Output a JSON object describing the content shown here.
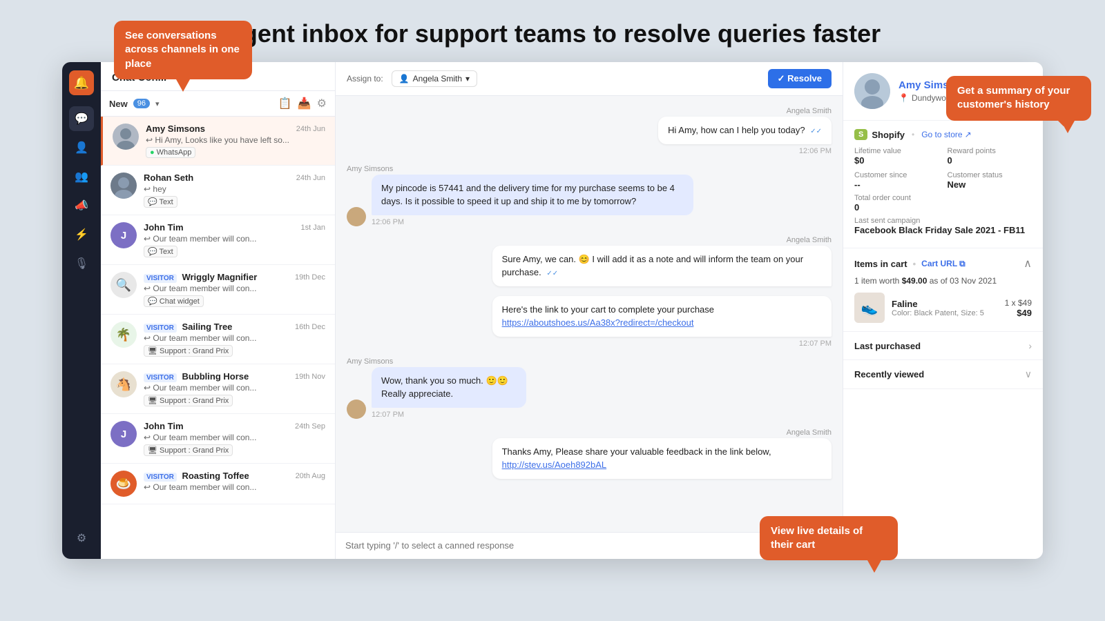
{
  "page": {
    "title": "Agent inbox for support teams to resolve queries faster"
  },
  "sidebar": {
    "logo_icon": "🔔",
    "items": [
      {
        "name": "conversations",
        "icon": "💬",
        "active": true
      },
      {
        "name": "contacts",
        "icon": "👤"
      },
      {
        "name": "teams",
        "icon": "👥"
      },
      {
        "name": "campaigns",
        "icon": "📣"
      },
      {
        "name": "automation",
        "icon": "⚡"
      },
      {
        "name": "reports",
        "icon": "🎙"
      },
      {
        "name": "settings",
        "icon": "⚙"
      }
    ]
  },
  "conv_list": {
    "header": "Chat Con...",
    "filter_label": "New",
    "filter_count": "96",
    "items": [
      {
        "name": "Amy Simsons",
        "snippet": "Hi Amy, Looks like you have left so...",
        "date": "24th Jun",
        "channel": "WhatsApp",
        "channel_icon": "💬",
        "avatar_text": "A",
        "avatar_class": "avatar-gray",
        "active": true
      },
      {
        "name": "Rohan Seth",
        "snippet": "hey",
        "date": "24th Jun",
        "channel": "Text",
        "channel_icon": "💬",
        "avatar_text": "R",
        "avatar_class": "avatar-gray",
        "is_visitor": false
      },
      {
        "name": "John Tim",
        "snippet": "Our team member will con...",
        "date": "1st Jan",
        "channel": "Text",
        "channel_icon": "💬",
        "avatar_text": "J",
        "avatar_class": "avatar-purple",
        "is_visitor": false
      },
      {
        "name": "Wriggly Magnifier",
        "snippet": "Our team member will con...",
        "date": "19th Dec",
        "channel": "Chat widget",
        "channel_icon": "💬",
        "avatar_text": "🔍",
        "avatar_class": "avatar-gray",
        "is_visitor": true
      },
      {
        "name": "Sailing Tree",
        "snippet": "Our team member will con...",
        "date": "16th Dec",
        "channel": "Support : Grand Prix",
        "channel_icon": "🌴",
        "avatar_text": "🌴",
        "avatar_class": "avatar-green",
        "is_visitor": true
      },
      {
        "name": "Bubbling Horse",
        "snippet": "Our team member will con...",
        "date": "19th Nov",
        "channel": "Support : Grand Prix",
        "channel_icon": "🐴",
        "avatar_text": "🐴",
        "avatar_class": "avatar-gray",
        "is_visitor": true
      },
      {
        "name": "John Tim",
        "snippet": "Our team member will con...",
        "date": "24th Sep",
        "channel": "Support : Grand Prix",
        "channel_icon": "💬",
        "avatar_text": "J",
        "avatar_class": "avatar-purple",
        "is_visitor": false
      },
      {
        "name": "Roasting Toffee",
        "snippet": "Our team member will con...",
        "date": "20th Aug",
        "channel": "",
        "channel_icon": "",
        "avatar_text": "🔴",
        "avatar_class": "avatar-red",
        "is_visitor": true
      }
    ]
  },
  "chat": {
    "assign_label": "Assign to:",
    "assignee": "Angela Smith",
    "resolve_label": "✓ Resolve",
    "messages": [
      {
        "type": "outgoing",
        "sender": "Angela Smith",
        "text": "Hi Amy, how can I help you today?",
        "time": "12:06 PM",
        "has_check": true
      },
      {
        "type": "incoming",
        "sender": "Amy Simsons",
        "text": "My pincode is 57441 and the delivery time for my purchase seems to be 4 days. Is it possible to speed it up and ship it to me by tomorrow?",
        "time": "12:06 PM",
        "has_check": false
      },
      {
        "type": "outgoing",
        "sender": "Angela Smith",
        "text": "Sure Amy, we can. 😊 I will add it as a note and will inform the team on your purchase.",
        "time": "",
        "has_check": true
      },
      {
        "type": "outgoing",
        "sender": "Angela Smith",
        "text": "Here's the link to your cart to complete your purchase",
        "link": "https://aboutshoes.us/Aa38x?redirect=/checkout",
        "time": "12:07 PM",
        "has_check": false
      },
      {
        "type": "incoming",
        "sender": "Amy Simsons",
        "text": "Wow, thank you so much. 🙂🙂 Really appreciate.",
        "time": "12:07 PM"
      },
      {
        "type": "outgoing",
        "sender": "Angela Smith",
        "text": "Thanks Amy, Please share your valuable feedback in the link below,",
        "link": "http://stev.us/Aoeh892bAL",
        "time": "",
        "has_check": false
      }
    ],
    "input_placeholder": "Start typing '/' to select a canned response"
  },
  "customer": {
    "name": "Amy Simson",
    "location": "Dundywood, Georgia, USA",
    "shopify_label": "Shopify",
    "go_to_store": "Go to store",
    "lifetime_value_label": "Lifetime value",
    "lifetime_value": "$0",
    "reward_points_label": "Reward points",
    "reward_points": "0",
    "customer_since_label": "Customer since",
    "customer_since": "--",
    "customer_status_label": "Customer status",
    "customer_status": "New",
    "total_order_label": "Total order count",
    "total_order": "0",
    "last_campaign_label": "Last sent campaign",
    "last_campaign": "Facebook Black Friday Sale 2021 - FB11",
    "cart": {
      "title": "Items in cart",
      "url_label": "Cart URL",
      "summary": "1 item worth $49.00 as of 03 Nov 2021",
      "items": [
        {
          "name": "Faline",
          "sub": "Color: Black Patent, Size: 5",
          "qty_price": "1 x $49",
          "total": "$49",
          "icon": "👟"
        }
      ]
    },
    "last_purchased_label": "Last purchased",
    "recently_viewed_label": "Recently viewed"
  },
  "callouts": {
    "top_left": "See conversations across channels in one place",
    "top_right": "Get a summary of your customer's history",
    "bottom_right": "View live details of their cart"
  }
}
